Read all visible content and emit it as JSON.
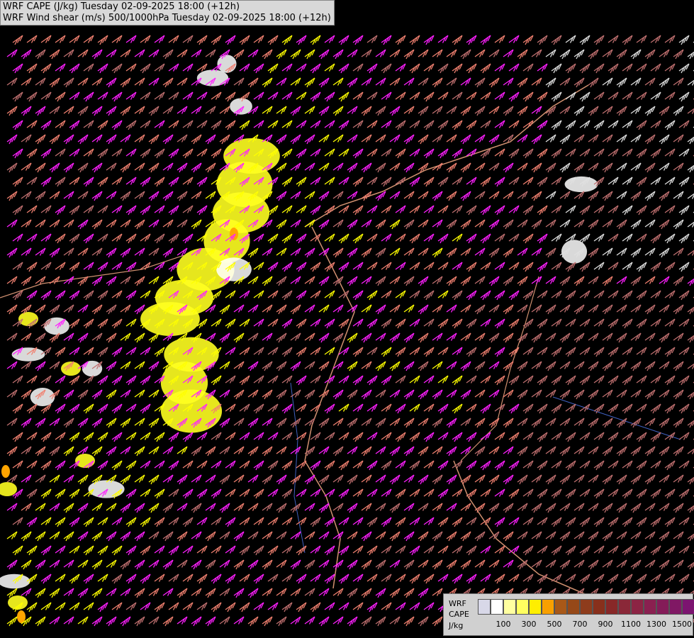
{
  "title": {
    "line1": "WRF CAPE (J/kg) Tuesday 02-09-2025 18:00 (+12h)",
    "line2": "WRF Wind shear (m/s) 500/1000hPa Tuesday 02-09-2025 18:00 (+12h)"
  },
  "legend": {
    "label_model": "WRF",
    "label_field": "CAPE",
    "label_unit": "J/kg",
    "colors": [
      "#d8d8e8",
      "#ffffff",
      "#ffffa0",
      "#ffff60",
      "#ffee00",
      "#f8a000",
      "#a85818",
      "#964818",
      "#8e3c1c",
      "#88301c",
      "#882828",
      "#8a2838",
      "#8c2444",
      "#8a2050",
      "#841c58",
      "#801864",
      "#7c1470"
    ],
    "ticks": [
      "100",
      "300",
      "500",
      "700",
      "900",
      "1100",
      "1300",
      "1500"
    ]
  },
  "map": {
    "background": "#000000",
    "barb_colors": {
      "weak": "#e0e0e0",
      "light": "#c07070",
      "moderate": "#f08070",
      "strong": "#ff20ff",
      "very_strong": "#ffff00"
    },
    "cape_colors": {
      "low": "#ffffff",
      "moderate": "#ffff20",
      "high": "#ffa500"
    },
    "border_color": "#d09070",
    "river_color": "#4060c0"
  }
}
